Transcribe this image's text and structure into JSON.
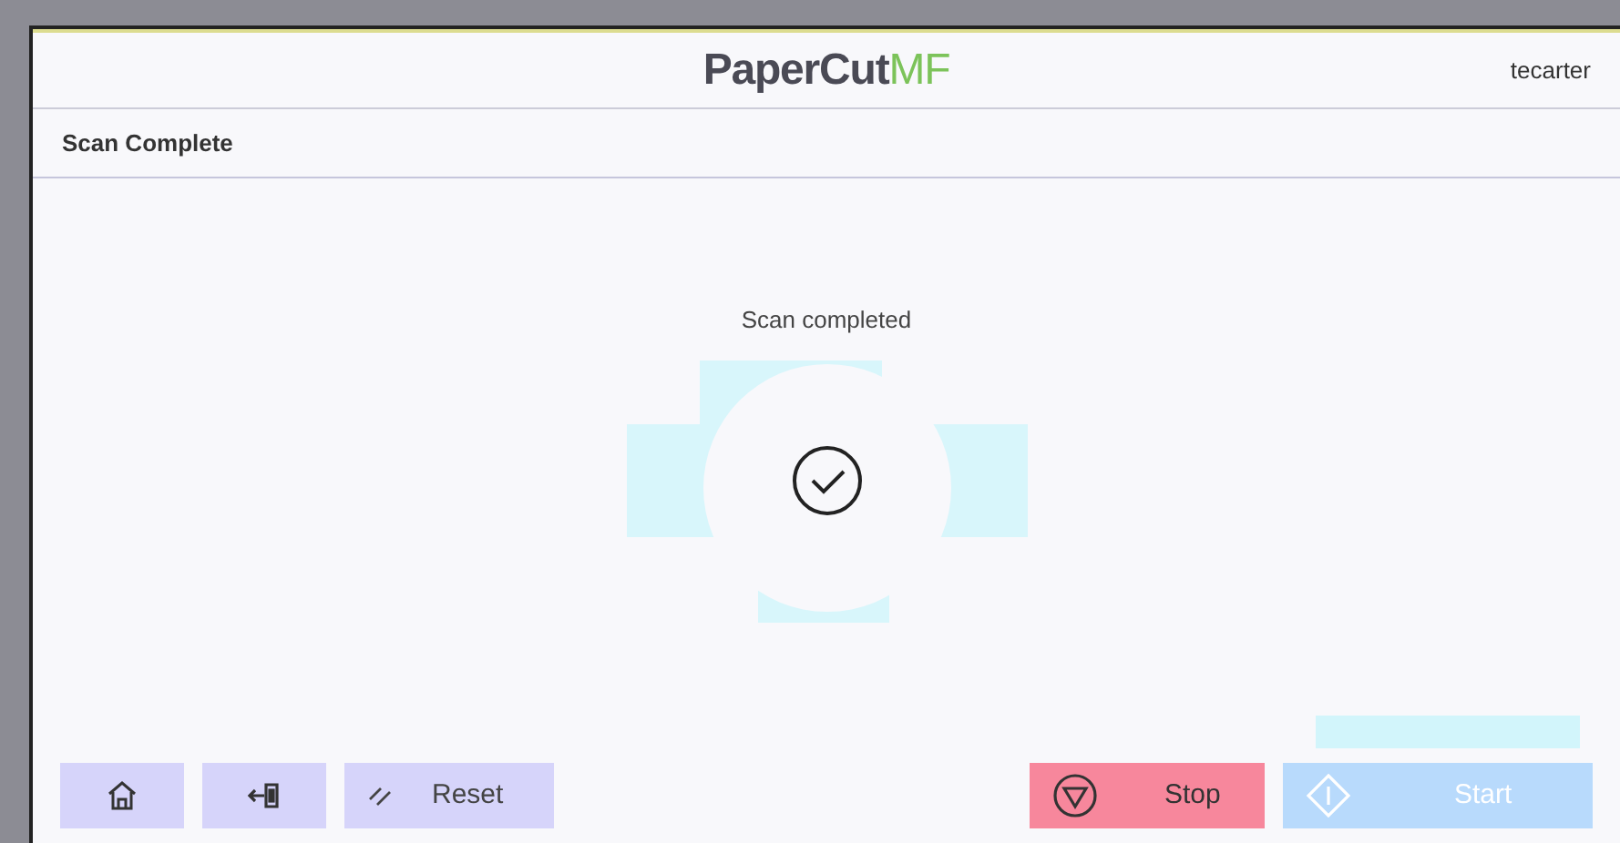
{
  "header": {
    "logo": {
      "main": "PaperCut",
      "accent": "MF"
    },
    "user": "tecarter"
  },
  "title": "Scan Complete",
  "status": {
    "message": "Scan completed"
  },
  "buttons": [
    {
      "kind": "home",
      "disabled": false
    },
    {
      "kind": "logout",
      "disabled": false
    },
    {
      "kind": "reset",
      "label": "Reset",
      "disabled": false
    },
    {
      "kind": "stop",
      "label": "Stop",
      "disabled": false
    },
    {
      "kind": "start",
      "label": "Start",
      "disabled": true
    }
  ]
}
